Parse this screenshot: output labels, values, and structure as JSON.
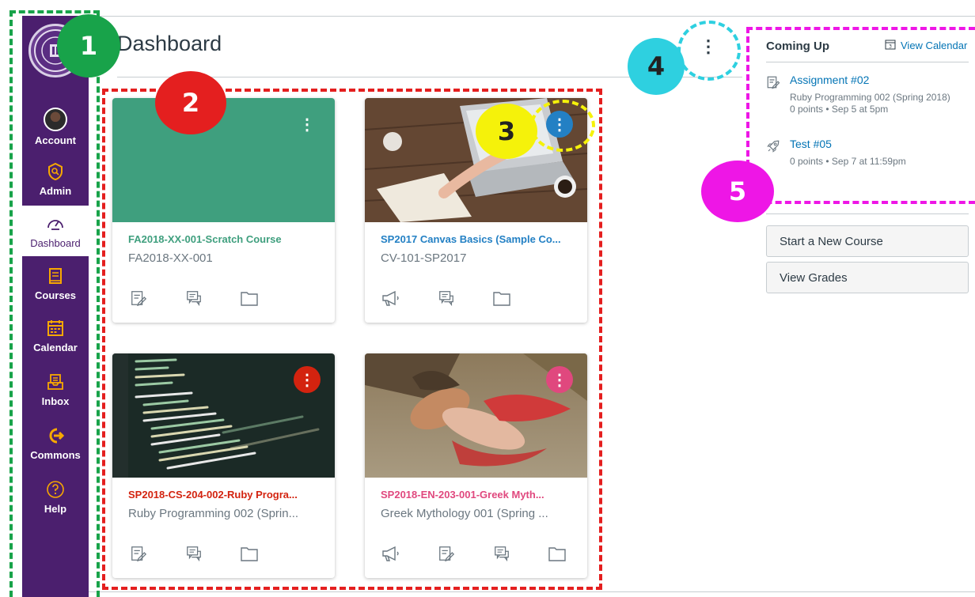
{
  "page": {
    "title": "Dashboard"
  },
  "sidebar": {
    "logo_text": "",
    "items": [
      {
        "label": "Account",
        "icon": "avatar"
      },
      {
        "label": "Admin",
        "icon": "shield-icon"
      },
      {
        "label": "Dashboard",
        "icon": "speedometer-icon",
        "active": true
      },
      {
        "label": "Courses",
        "icon": "book-icon"
      },
      {
        "label": "Calendar",
        "icon": "calendar-icon"
      },
      {
        "label": "Inbox",
        "icon": "inbox-icon"
      },
      {
        "label": "Commons",
        "icon": "commons-arrow-icon"
      },
      {
        "label": "Help",
        "icon": "help-icon"
      }
    ]
  },
  "cards": [
    {
      "name": "FA2018-XX-001-Scratch Course",
      "code": "FA2018-XX-001",
      "color": "#3f9f7e",
      "image": "solid-teal",
      "actions": [
        "assignments-icon",
        "discussions-icon",
        "files-icon"
      ]
    },
    {
      "name": "SP2017 Canvas Basics (Sample Co...",
      "code": "CV-101-SP2017",
      "color": "#2380c4",
      "image": "desk-laptop-photo",
      "actions": [
        "announcements-icon",
        "discussions-icon",
        "files-icon"
      ]
    },
    {
      "name": "SP2018-CS-204-002-Ruby Progra...",
      "code": "Ruby Programming 002 (Sprin...",
      "color": "#d3230f",
      "image": "code-screen-photo",
      "actions": [
        "assignments-icon",
        "discussions-icon",
        "files-icon"
      ]
    },
    {
      "name": "SP2018-EN-203-001-Greek Myth...",
      "code": "Greek Mythology 001 (Spring ...",
      "color": "#e0487e",
      "image": "painting-photo",
      "actions": [
        "announcements-icon",
        "assignments-icon",
        "discussions-icon",
        "files-icon"
      ]
    }
  ],
  "coming_up": {
    "title": "Coming Up",
    "view_calendar": "View Calendar",
    "items": [
      {
        "title": "Assignment #02",
        "lines": [
          "Ruby Programming 002 (Spring 2018)",
          "0 points • Sep 5 at 5pm"
        ],
        "icon": "assignment-icon"
      },
      {
        "title": "Test #05",
        "lines": [
          "0 points • Sep 7 at 11:59pm"
        ],
        "icon": "rocket-icon"
      }
    ]
  },
  "buttons": {
    "new_course": "Start a New Course",
    "view_grades": "View Grades"
  },
  "annotations": [
    {
      "num": "1",
      "color": "#18a34a",
      "border": "#18a34a",
      "text_color": "#ffffff"
    },
    {
      "num": "2",
      "color": "#e41f1f",
      "border": "#e41f1f",
      "text_color": "#ffffff"
    },
    {
      "num": "3",
      "color": "#f5f20a",
      "border": "#f5f20a",
      "text_color": "#222222"
    },
    {
      "num": "4",
      "color": "#2ed0e0",
      "border": "#2ed0e0",
      "text_color": "#222222"
    },
    {
      "num": "5",
      "color": "#ee16e6",
      "border": "#ee16e6",
      "text_color": "#ffffff"
    }
  ]
}
